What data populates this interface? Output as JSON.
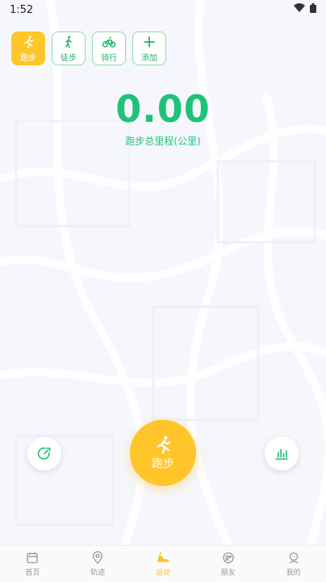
{
  "status": {
    "time": "1:52"
  },
  "modes": [
    {
      "label": "跑步",
      "icon": "running-icon",
      "active": true
    },
    {
      "label": "徒步",
      "icon": "walking-icon",
      "active": false
    },
    {
      "label": "骑行",
      "icon": "bicycle-icon",
      "active": false
    },
    {
      "label": "添加",
      "icon": "plus-icon",
      "active": false
    }
  ],
  "summary": {
    "distance": "0.00",
    "label": "跑步总里程(公里)"
  },
  "start_button": {
    "label": "跑步"
  },
  "tabs": [
    {
      "label": "首页",
      "icon": "calendar-icon",
      "active": false
    },
    {
      "label": "轨迹",
      "icon": "map-pin-icon",
      "active": false
    },
    {
      "label": "运动",
      "icon": "sport-shoe-icon",
      "active": true
    },
    {
      "label": "朋友",
      "icon": "friends-icon",
      "active": false
    },
    {
      "label": "我的",
      "icon": "profile-icon",
      "active": false
    }
  ],
  "colors": {
    "accent_green": "#1fc27a",
    "accent_yellow": "#ffc52b"
  }
}
